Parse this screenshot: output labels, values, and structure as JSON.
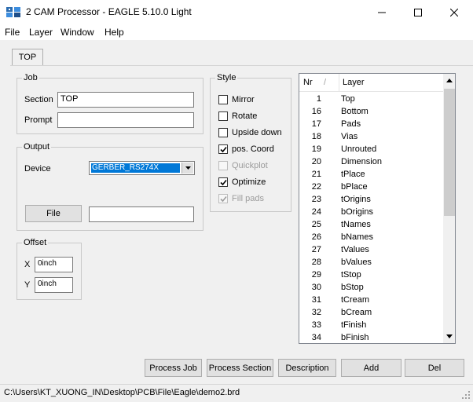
{
  "window": {
    "title": "2 CAM Processor - EAGLE 5.10.0 Light",
    "minimize_icon": "minimize-icon",
    "maximize_icon": "maximize-icon",
    "close_icon": "close-icon"
  },
  "menu": [
    "File",
    "Layer",
    "Window",
    "Help"
  ],
  "tab": {
    "label": "TOP"
  },
  "job": {
    "title": "Job",
    "section_label": "Section",
    "section_value": "TOP",
    "prompt_label": "Prompt",
    "prompt_value": ""
  },
  "output": {
    "title": "Output",
    "device_label": "Device",
    "device_value": "GERBER_RS274X",
    "file_button": "File",
    "file_value": ""
  },
  "offset": {
    "title": "Offset",
    "x_label": "X",
    "x_value": "0inch",
    "y_label": "Y",
    "y_value": "0inch"
  },
  "style": {
    "title": "Style",
    "options": [
      {
        "label": "Mirror",
        "checked": false,
        "enabled": true
      },
      {
        "label": "Rotate",
        "checked": false,
        "enabled": true
      },
      {
        "label": "Upside down",
        "checked": false,
        "enabled": true
      },
      {
        "label": "pos. Coord",
        "checked": true,
        "enabled": true
      },
      {
        "label": "Quickplot",
        "checked": false,
        "enabled": false
      },
      {
        "label": "Optimize",
        "checked": true,
        "enabled": true
      },
      {
        "label": "Fill pads",
        "checked": true,
        "enabled": false
      }
    ]
  },
  "layers": {
    "col_nr": "Nr",
    "col_sort": "/",
    "col_layer": "Layer",
    "rows": [
      {
        "nr": "1",
        "name": "Top"
      },
      {
        "nr": "16",
        "name": "Bottom"
      },
      {
        "nr": "17",
        "name": "Pads"
      },
      {
        "nr": "18",
        "name": "Vias"
      },
      {
        "nr": "19",
        "name": "Unrouted"
      },
      {
        "nr": "20",
        "name": "Dimension"
      },
      {
        "nr": "21",
        "name": "tPlace"
      },
      {
        "nr": "22",
        "name": "bPlace"
      },
      {
        "nr": "23",
        "name": "tOrigins"
      },
      {
        "nr": "24",
        "name": "bOrigins"
      },
      {
        "nr": "25",
        "name": "tNames"
      },
      {
        "nr": "26",
        "name": "bNames"
      },
      {
        "nr": "27",
        "name": "tValues"
      },
      {
        "nr": "28",
        "name": "bValues"
      },
      {
        "nr": "29",
        "name": "tStop"
      },
      {
        "nr": "30",
        "name": "bStop"
      },
      {
        "nr": "31",
        "name": "tCream"
      },
      {
        "nr": "32",
        "name": "bCream"
      },
      {
        "nr": "33",
        "name": "tFinish"
      },
      {
        "nr": "34",
        "name": "bFinish"
      }
    ]
  },
  "buttons": {
    "process_job": "Process Job",
    "process_section": "Process Section",
    "description": "Description",
    "add": "Add",
    "del": "Del"
  },
  "status": {
    "path": "C:\\Users\\KT_XUONG_IN\\Desktop\\PCB\\File\\Eagle\\demo2.brd"
  },
  "colors": {
    "selection": "#0078d7",
    "window_bg": "#f0f0f0"
  }
}
